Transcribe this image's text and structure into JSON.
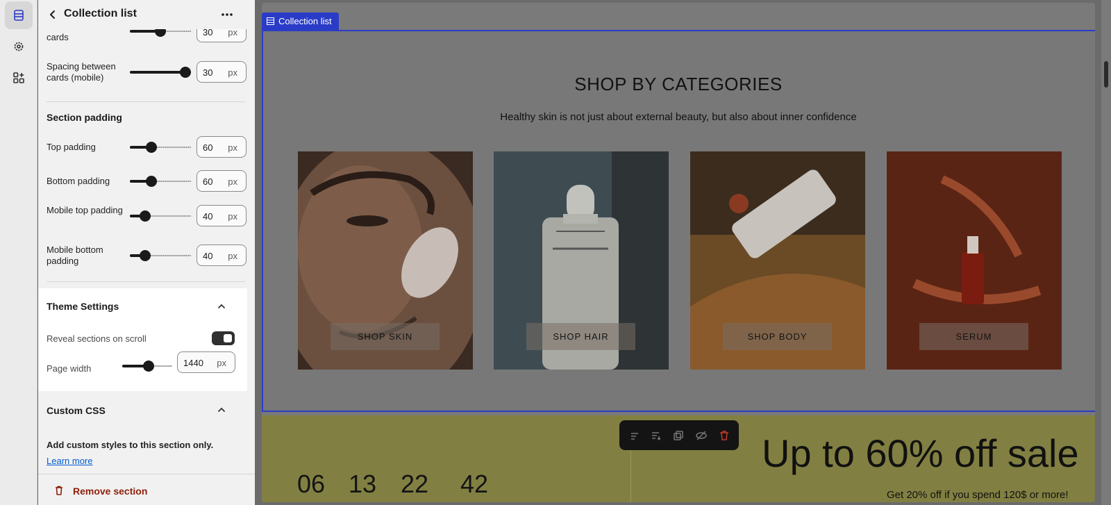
{
  "rail": {
    "items": [
      "sections-icon",
      "settings-icon",
      "apps-icon"
    ]
  },
  "panel": {
    "title": "Collection list",
    "spacing_cards_label": "cards",
    "spacing_cards_value": "30",
    "spacing_mobile_label": "Spacing between cards (mobile)",
    "spacing_mobile_value": "30",
    "unit": "px",
    "section_padding_title": "Section padding",
    "paddings": [
      {
        "label": "Top padding",
        "value": "60",
        "level": 0.35
      },
      {
        "label": "Bottom padding",
        "value": "60",
        "level": 0.35
      },
      {
        "label": "Mobile top padding",
        "value": "40",
        "level": 0.25
      },
      {
        "label": "Mobile bottom padding",
        "value": "40",
        "level": 0.25
      }
    ],
    "theme_settings_title": "Theme Settings",
    "reveal_label": "Reveal sections on scroll",
    "reveal_on": true,
    "page_width_label": "Page width",
    "page_width_value": "1440",
    "custom_css_title": "Custom CSS",
    "custom_css_desc": "Add custom styles to this section only.",
    "learn_more": "Learn more",
    "remove_section": "Remove section"
  },
  "preview": {
    "tag": "Collection list",
    "title": "SHOP BY CATEGORIES",
    "subtitle": "Healthy skin is not just about external beauty, but also about inner confidence",
    "cards": [
      {
        "button": "SHOP SKIN"
      },
      {
        "button": "SHOP HAIR"
      },
      {
        "button": "SHOP BODY"
      },
      {
        "button": "SERUM"
      }
    ],
    "countdown": [
      "06",
      "13",
      "22",
      "42"
    ],
    "sale_title": "Up to 60% off sale",
    "sale_sub": "Get 20% off if you spend 120$ or more!"
  },
  "colors": {
    "selection": "#2a3cc7",
    "danger": "#8e1f0b",
    "toggle": "#303030"
  }
}
